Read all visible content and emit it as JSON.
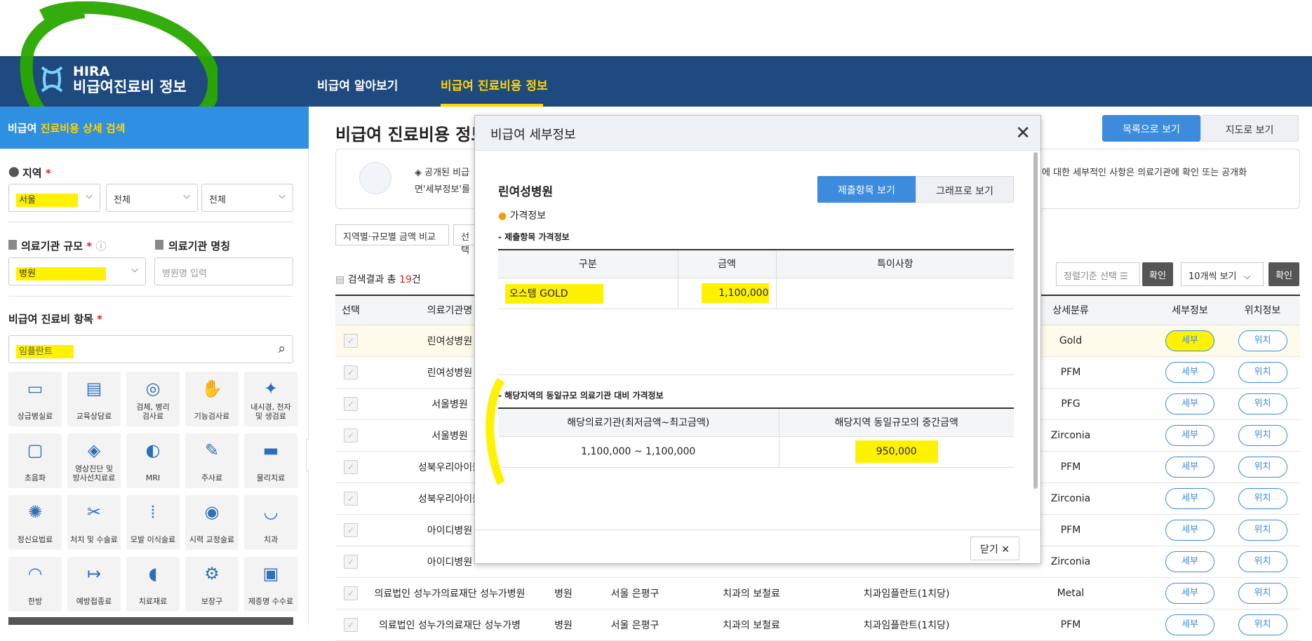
{
  "header": {
    "logo_top": "HIRA",
    "logo_sub": "비급여진료비 정보",
    "nav": [
      "비급여 알아보기",
      "비급여 진료비용 정보"
    ]
  },
  "sidebar": {
    "title_a": "비급여 ",
    "title_b": "진료비용 상세 검색",
    "region_label": "지역",
    "region_values": [
      "서울",
      "전체",
      "전체"
    ],
    "size_label": "의료기관 규모",
    "size_value": "병원",
    "name_label": "의료기관 명칭",
    "name_placeholder": "병원명 입력",
    "items_label": "비급여 진료비 항목",
    "items_value": "임플란트",
    "categories": [
      "상급병실료",
      "교육상담료",
      "검체, 병리\n검사료",
      "기능검사료",
      "내시경, 천자\n및 생검료",
      "초음파",
      "영상진단 및\n방사선치료료",
      "MRI",
      "주사료",
      "물리치료",
      "정신요법료",
      "처치 및 수술료",
      "모발 이식술료",
      "시력 교정술료",
      "치과",
      "한방",
      "예방접종료",
      "치료재료",
      "보장구",
      "제증명 수수료"
    ]
  },
  "main": {
    "title": "비급여 진료비용 정보",
    "view_list": "목록으로 보기",
    "view_map": "지도로 보기",
    "info_a": "◈ 공개된 비급",
    "info_b": "에 대한 세부적인 사항은 의료기관에 확인 또는 공개화",
    "info_c": "면'세부정보'를",
    "filter1": "지역별·규모별 금액 비교",
    "filter2": "선택",
    "result_prefix": "검색결과 총 ",
    "result_count": "19",
    "result_suffix": "건",
    "sort_label": "정렬기준 선택",
    "confirm": "확인",
    "page_size": "10개씩 보기",
    "columns": [
      "선택",
      "의료기관명",
      "",
      "",
      "",
      "",
      "상세분류",
      "세부정보",
      "위치정보"
    ],
    "detail_btn": "세부",
    "loc_btn": "위치",
    "rows": [
      {
        "name": "린여성병원",
        "type": "",
        "region": "",
        "cat": "",
        "item": "",
        "sub": "Gold"
      },
      {
        "name": "린여성병원",
        "type": "",
        "region": "",
        "cat": "",
        "item": "",
        "sub": "PFM"
      },
      {
        "name": "서울병원",
        "type": "",
        "region": "",
        "cat": "",
        "item": "",
        "sub": "PFG"
      },
      {
        "name": "서울병원",
        "type": "",
        "region": "",
        "cat": "",
        "item": "",
        "sub": "Zirconia"
      },
      {
        "name": "성북우리아이들",
        "type": "",
        "region": "",
        "cat": "",
        "item": "",
        "sub": "PFM"
      },
      {
        "name": "성북우리아이들",
        "type": "",
        "region": "",
        "cat": "",
        "item": "",
        "sub": "Zirconia"
      },
      {
        "name": "아이디병원",
        "type": "",
        "region": "",
        "cat": "",
        "item": "",
        "sub": "PFM"
      },
      {
        "name": "아이디병원",
        "type": "",
        "region": "",
        "cat": "",
        "item": "",
        "sub": "Zirconia"
      },
      {
        "name": "의료법인 성누가의료재단 성누가병원",
        "type": "병원",
        "region": "서울 은평구",
        "cat": "치과의 보철료",
        "item": "치과임플란트(1치당)",
        "sub": "Metal"
      },
      {
        "name": "의료법인 성누가의료재단 성누가병",
        "type": "병원",
        "region": "서울 은평구",
        "cat": "치과의 보철료",
        "item": "치과임플란트(1치당)",
        "sub": "PFM"
      }
    ]
  },
  "modal": {
    "title": "비급여 세부정보",
    "hospital": "린여성병원",
    "tab1": "제출항목 보기",
    "tab2": "그래프로 보기",
    "section": "가격정보",
    "sub1": "- 제출항목 가격정보",
    "cols1": [
      "구분",
      "금액",
      "특이사항"
    ],
    "row1": [
      "오스템 GOLD",
      "1,100,000",
      ""
    ],
    "sub2": "- 해당지역의 동일규모 의료기관 대비 가격정보",
    "cols2": [
      "해당의료기관(최저금액~최고금액)",
      "해당지역 동일규모의 중간금액"
    ],
    "row2": [
      "1,100,000 ~ 1,100,000",
      "950,000"
    ],
    "close": "닫기"
  }
}
